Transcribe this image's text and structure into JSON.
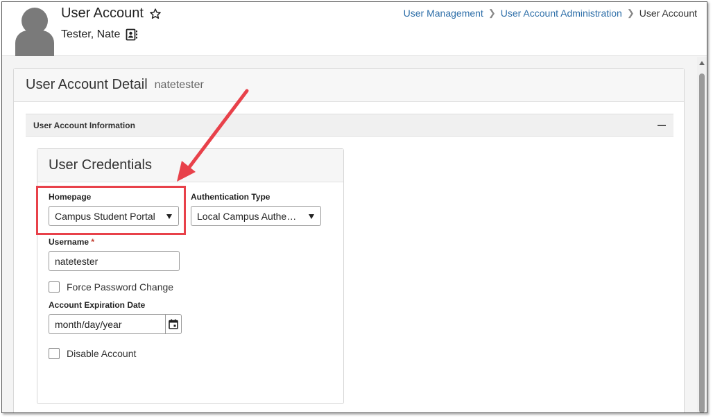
{
  "header": {
    "title": "User Account",
    "person_name": "Tester, Nate",
    "breadcrumb": {
      "items": [
        "User Management",
        "User Account Administration"
      ],
      "current": "User Account"
    }
  },
  "detail": {
    "title": "User Account Detail",
    "username": "natetester",
    "section_title": "User Account Information"
  },
  "credentials": {
    "title": "User Credentials",
    "homepage_label": "Homepage",
    "homepage_value": "Campus Student Portal",
    "auth_label": "Authentication Type",
    "auth_value": "Local Campus Authe…",
    "username_label": "Username",
    "username_required": "*",
    "username_value": "natetester",
    "force_password_label": "Force Password Change",
    "expiration_label": "Account Expiration Date",
    "expiration_placeholder": "month/day/year",
    "disable_label": "Disable Account"
  },
  "icons": {
    "favorite": "star-outline-icon",
    "contact": "contact-card-icon",
    "calendar": "calendar-icon",
    "collapse": "minus-icon"
  },
  "colors": {
    "link": "#2d6ea8",
    "highlight": "#e8414a",
    "required": "#c0392b"
  }
}
